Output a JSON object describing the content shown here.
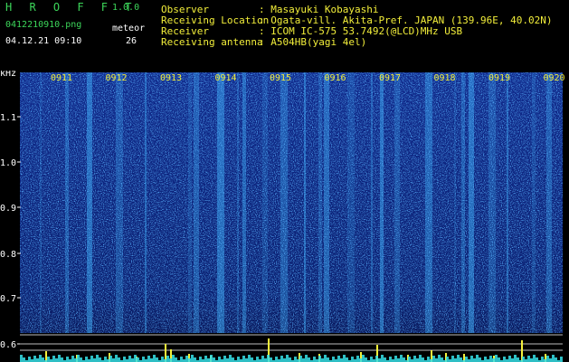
{
  "header": {
    "app_title": "H R O F F T",
    "app_version": "1.0.0",
    "filename": "0412210910.png",
    "datetime": "04.12.21 09:10",
    "meteor_label": "meteor",
    "meteor_count": "26"
  },
  "info": {
    "observer_label": "Observer",
    "observer_value": ": Masayuki Kobayashi",
    "location_label": "Receiving Location",
    "location_value": ": Ogata-vill. Akita-Pref. JAPAN (139.96E, 40.02N)",
    "receiver_label": "Receiver",
    "receiver_value": ": ICOM IC-575 53.7492(@LCD)MHz USB",
    "antenna_label": "Receiving antenna",
    "antenna_value": ": A504HB(yagi 4el)"
  },
  "axis": {
    "unit_label": "kHz",
    "y_ticks": [
      "1.1",
      "1.0",
      "0.9",
      "0.8",
      "0.7",
      "0.6"
    ],
    "time_ticks": [
      "0911",
      "0912",
      "0913",
      "0914",
      "0915",
      "0916",
      "0917",
      "0918",
      "0919",
      "0920"
    ]
  },
  "colors": {
    "background": "#000000",
    "header_green": "#3cd65a",
    "time_label_yellow": "#f2ee3a",
    "spectrum_base": "#0a1f7a",
    "spectrum_bright": "#3fb8ff",
    "signal_cyan": "#36e0e8",
    "signal_yellow": "#f5f03a"
  }
}
